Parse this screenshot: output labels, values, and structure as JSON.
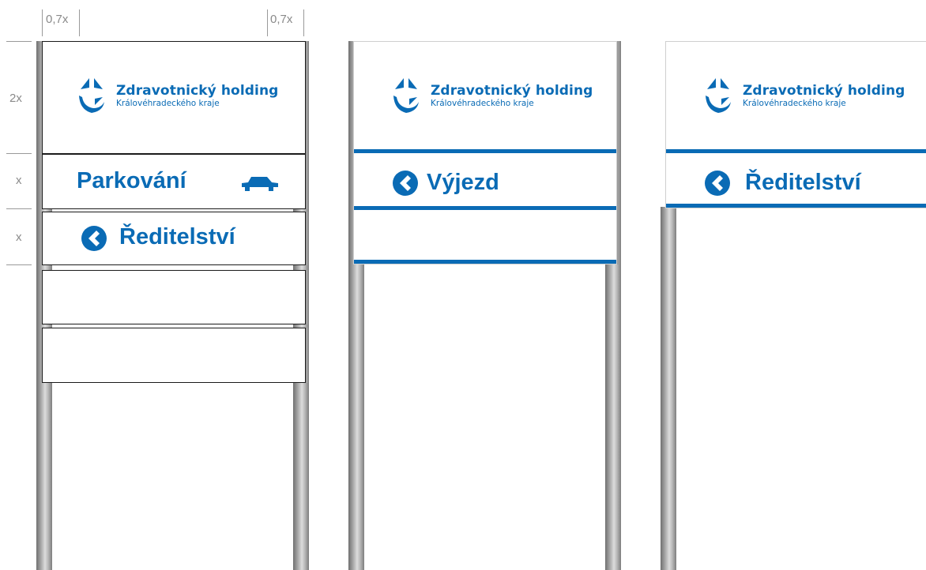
{
  "annotations": {
    "top_left_width": "0,7x",
    "top_right_width": "0,7x",
    "row_header": "2x",
    "row_parking": "x",
    "row_director": "x"
  },
  "logo": {
    "name": "Zdravotnický holding",
    "subtitle": "Královéhradeckého kraje"
  },
  "sign1": {
    "row1_label": "Parkování",
    "row1_icon": "car-icon",
    "row2_label": "Ředitelství",
    "row2_icon": "arrow-left-circle-icon"
  },
  "sign2": {
    "row1_label": "Výjezd",
    "row1_icon": "arrow-left-circle-icon"
  },
  "sign3": {
    "row1_label": "Ředitelství",
    "row1_icon": "arrow-left-circle-icon"
  },
  "colors": {
    "brand_blue": "#0a6bb5",
    "pole_gray": "#a9a9a9",
    "annotation_gray": "#8a8a8a"
  }
}
